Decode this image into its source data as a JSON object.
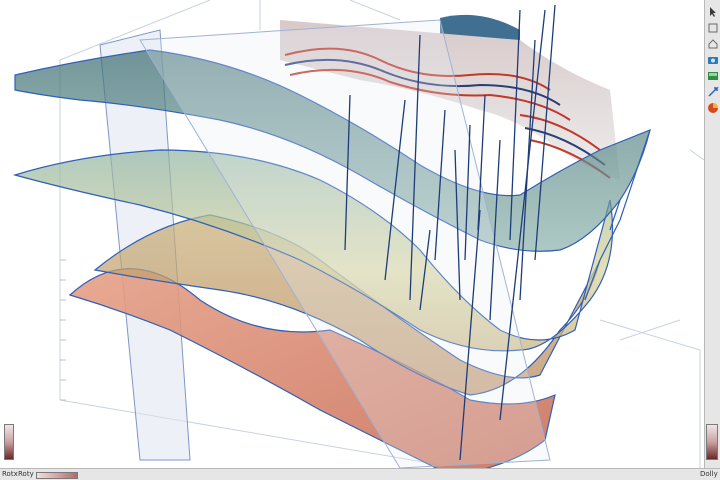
{
  "statusbar": {
    "rotx_label": "Rotx",
    "roty_label": "Roty",
    "dolly_label": "Dolly"
  },
  "toolbar": {
    "tools": [
      {
        "name": "pointer-icon",
        "color": "#3a3a3a"
      },
      {
        "name": "view-icon",
        "color": "#6a6a6a"
      },
      {
        "name": "home-icon",
        "color": "#6a6a6a"
      },
      {
        "name": "camera-icon",
        "color": "#2a7ab8"
      },
      {
        "name": "surface-icon",
        "color": "#2f8f3f"
      },
      {
        "name": "seek-icon",
        "color": "#2a64c8"
      },
      {
        "name": "color-icon",
        "color": "#d24a1e"
      }
    ]
  },
  "colors": {
    "horizon_top": "#5f8f8c",
    "horizon_mid": "#c9c98a",
    "horizon_bottom": "#d98a70",
    "edge_line": "#2f5fb8",
    "wells": "#1e3c78"
  }
}
